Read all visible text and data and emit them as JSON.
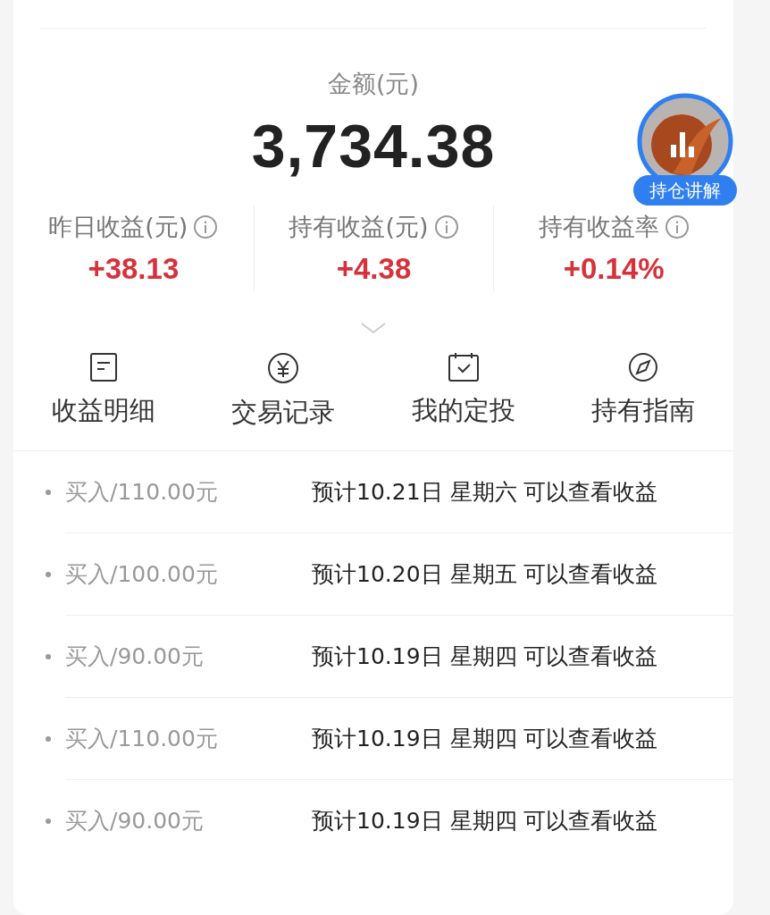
{
  "amount": {
    "label": "金额(元)",
    "value": "3,734.38"
  },
  "badge": {
    "label": "持仓讲解"
  },
  "stats": [
    {
      "label": "昨日收益(元)",
      "value": "+38.13"
    },
    {
      "label": "持有收益(元)",
      "value": "+4.38"
    },
    {
      "label": "持有收益率",
      "value": "+0.14%"
    }
  ],
  "shortcuts": [
    {
      "kind": "document",
      "label": "收益明细"
    },
    {
      "kind": "yen",
      "label": "交易记录"
    },
    {
      "kind": "calendar",
      "label": "我的定投"
    },
    {
      "kind": "compass",
      "label": "持有指南"
    }
  ],
  "records": [
    {
      "action": "买入/110.00元",
      "note": "预计10.21日 星期六 可以查看收益"
    },
    {
      "action": "买入/100.00元",
      "note": "预计10.20日 星期五 可以查看收益"
    },
    {
      "action": "买入/90.00元",
      "note": "预计10.19日 星期四 可以查看收益"
    },
    {
      "action": "买入/110.00元",
      "note": "预计10.19日 星期四 可以查看收益"
    },
    {
      "action": "买入/90.00元",
      "note": "预计10.19日 星期四 可以查看收益"
    }
  ]
}
